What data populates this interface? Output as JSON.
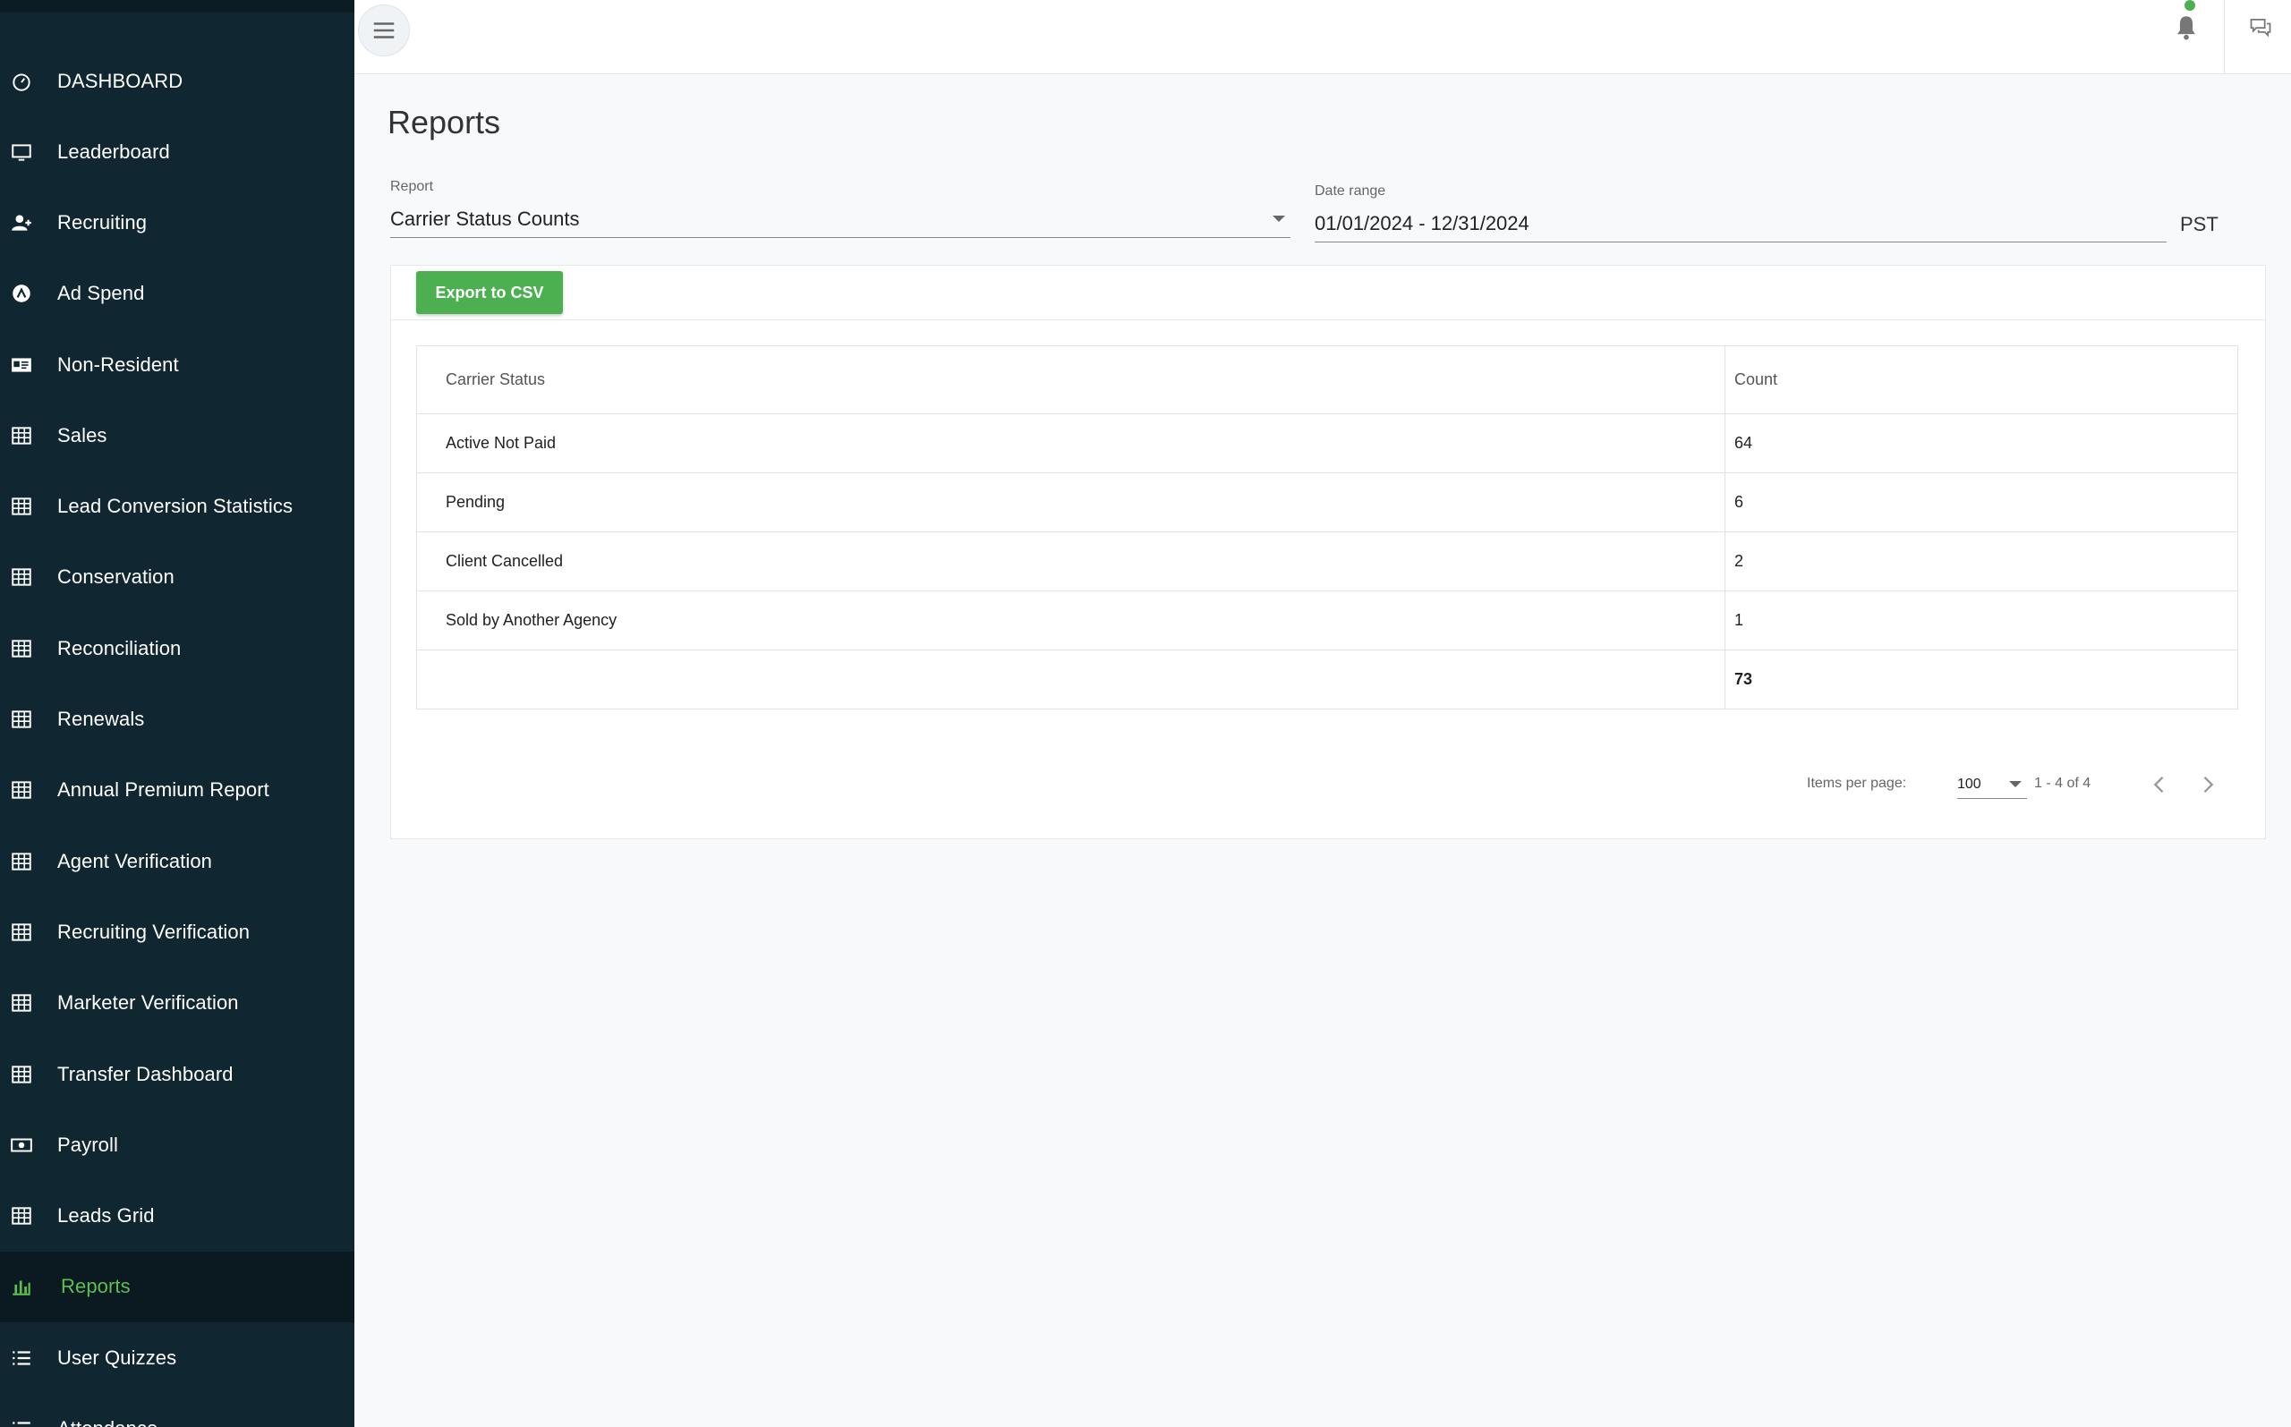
{
  "sidebar": {
    "items": [
      {
        "label": "DASHBOARD",
        "icon": "speedometer-icon"
      },
      {
        "label": "Leaderboard",
        "icon": "monitor-icon"
      },
      {
        "label": "Recruiting",
        "icon": "user-plus-icon"
      },
      {
        "label": "Ad Spend",
        "icon": "ad-icon"
      },
      {
        "label": "Non-Resident",
        "icon": "id-card-icon"
      },
      {
        "label": "Sales",
        "icon": "table-icon"
      },
      {
        "label": "Lead Conversion Statistics",
        "icon": "table-icon"
      },
      {
        "label": "Conservation",
        "icon": "table-icon"
      },
      {
        "label": "Reconciliation",
        "icon": "table-icon"
      },
      {
        "label": "Renewals",
        "icon": "table-icon"
      },
      {
        "label": "Annual Premium Report",
        "icon": "table-icon"
      },
      {
        "label": "Agent Verification",
        "icon": "table-icon"
      },
      {
        "label": "Recruiting Verification",
        "icon": "table-icon"
      },
      {
        "label": "Marketer Verification",
        "icon": "table-icon"
      },
      {
        "label": "Transfer Dashboard",
        "icon": "table-icon"
      },
      {
        "label": "Payroll",
        "icon": "money-icon"
      },
      {
        "label": "Leads Grid",
        "icon": "table-icon"
      },
      {
        "label": "Reports",
        "icon": "bar-chart-icon",
        "active": true
      },
      {
        "label": "User Quizzes",
        "icon": "list-icon"
      },
      {
        "label": "Attendance",
        "icon": "list-icon"
      }
    ]
  },
  "header": {
    "notification_status_color": "#4caf50"
  },
  "page": {
    "title": "Reports",
    "report_label": "Report",
    "report_value": "Carrier Status Counts",
    "date_label": "Date range",
    "date_value": "01/01/2024 - 12/31/2024",
    "timezone": "PST",
    "export_label": "Export to CSV"
  },
  "table": {
    "columns": [
      "Carrier Status",
      "Count"
    ],
    "rows": [
      {
        "status": "Active Not Paid",
        "count": "64"
      },
      {
        "status": "Pending",
        "count": "6"
      },
      {
        "status": "Client Cancelled",
        "count": "2"
      },
      {
        "status": "Sold by Another Agency",
        "count": "1"
      }
    ],
    "total": "73"
  },
  "paginator": {
    "items_per_page_label": "Items per page:",
    "items_per_page": "100",
    "range": "1 - 4 of 4"
  },
  "colors": {
    "sidebar_bg": "#102630",
    "accent_green": "#4caf50"
  }
}
